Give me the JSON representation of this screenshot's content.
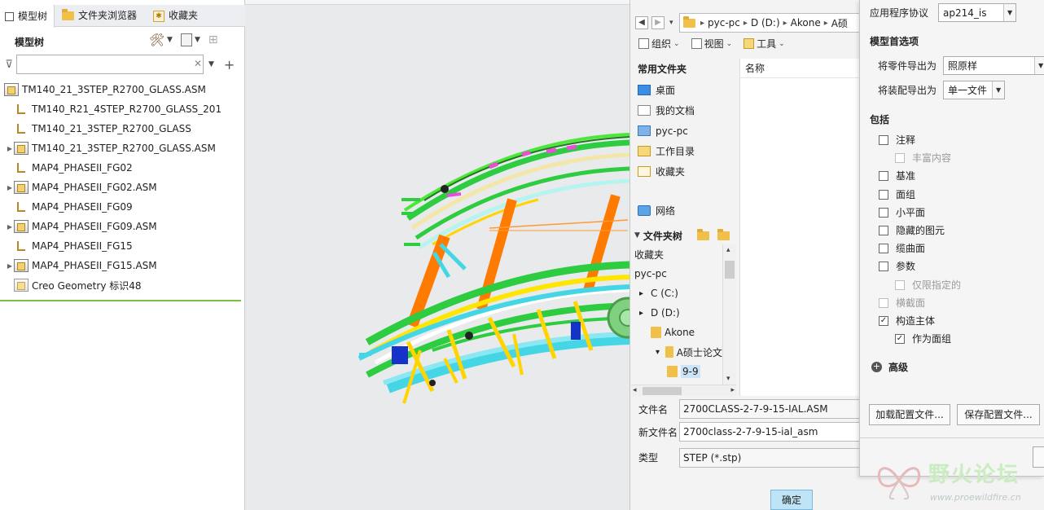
{
  "left_panel": {
    "tabs": [
      {
        "label": "模型树",
        "icon": "model-tree-icon"
      },
      {
        "label": "文件夹浏览器",
        "icon": "folder-browser-icon"
      },
      {
        "label": "收藏夹",
        "icon": "favorites-icon"
      }
    ],
    "title": "模型树",
    "filter": {
      "value": "",
      "placeholder": ""
    },
    "nodes": [
      {
        "label": "TM140_21_3STEP_R2700_GLASS.ASM",
        "type": "asm",
        "expandable": false,
        "indent": 0
      },
      {
        "label": "TM140_R21_4STEP_R2700_GLASS_201",
        "type": "part",
        "expandable": false,
        "indent": 1
      },
      {
        "label": "TM140_21_3STEP_R2700_GLASS",
        "type": "part",
        "expandable": false,
        "indent": 1
      },
      {
        "label": "TM140_21_3STEP_R2700_GLASS.ASM",
        "type": "asm",
        "expandable": true,
        "indent": 1
      },
      {
        "label": "MAP4_PHASEII_FG02",
        "type": "part",
        "expandable": false,
        "indent": 1
      },
      {
        "label": "MAP4_PHASEII_FG02.ASM",
        "type": "asm",
        "expandable": true,
        "indent": 1
      },
      {
        "label": "MAP4_PHASEII_FG09",
        "type": "part",
        "expandable": false,
        "indent": 1
      },
      {
        "label": "MAP4_PHASEII_FG09.ASM",
        "type": "asm",
        "expandable": true,
        "indent": 1
      },
      {
        "label": "MAP4_PHASEII_FG15",
        "type": "part",
        "expandable": false,
        "indent": 1
      },
      {
        "label": "MAP4_PHASEII_FG15.ASM",
        "type": "asm",
        "expandable": true,
        "indent": 1
      },
      {
        "label": "Creo Geometry 标识48",
        "type": "geom",
        "expandable": false,
        "indent": 1
      }
    ]
  },
  "dialog": {
    "breadcrumbs": [
      "pyc-pc",
      "D (D:)",
      "Akone",
      "A硕"
    ],
    "toolbar": {
      "organize": "组织",
      "view": "视图",
      "tools": "工具"
    },
    "places_title": "常用文件夹",
    "places": [
      {
        "label": "桌面",
        "icon": "desktop-icon",
        "cls": "desktop"
      },
      {
        "label": "我的文档",
        "icon": "documents-icon",
        "cls": "doc"
      },
      {
        "label": "pyc-pc",
        "icon": "computer-icon",
        "cls": "pc"
      },
      {
        "label": "工作目录",
        "icon": "working-directory-icon",
        "cls": "work"
      },
      {
        "label": "收藏夹",
        "icon": "favorites-icon",
        "cls": "fav"
      }
    ],
    "network": "网络",
    "folder_tree_title": "文件夹树",
    "folder_tree": [
      {
        "label": "收藏夹",
        "exp": "",
        "folder": false,
        "indent": 0,
        "sel": false
      },
      {
        "label": "pyc-pc",
        "exp": "",
        "folder": false,
        "indent": 0,
        "sel": false
      },
      {
        "label": "C (C:)",
        "exp": "▸",
        "folder": false,
        "indent": 1,
        "sel": false
      },
      {
        "label": "D (D:)",
        "exp": "▸",
        "folder": false,
        "indent": 1,
        "sel": false
      },
      {
        "label": "Akone",
        "exp": "",
        "folder": true,
        "indent": 2,
        "sel": false
      },
      {
        "label": "A硕士论文",
        "exp": "▾",
        "folder": true,
        "indent": 3,
        "sel": false
      },
      {
        "label": "9-9",
        "exp": "",
        "folder": true,
        "indent": 4,
        "sel": true
      }
    ],
    "list_header": "名称",
    "file_name_label": "文件名",
    "file_name_value": "2700CLASS-2-7-9-15-IAL.ASM",
    "new_name_label": "新文件名",
    "new_name_value": "2700class-2-7-9-15-ial_asm",
    "type_label": "类型",
    "type_value": "STEP (*.stp)",
    "ok_label": "确定"
  },
  "options": {
    "protocol_label": "应用程序协议",
    "protocol_value": "ap214_is",
    "model_prefs_title": "模型首选项",
    "export_parts_label": "将零件导出为",
    "export_parts_value": "照原样",
    "export_asm_label": "将装配导出为",
    "export_asm_value": "单一文件",
    "include_title": "包括",
    "includes": [
      {
        "label": "注释",
        "checked": false,
        "disabled": false,
        "indent": 0
      },
      {
        "label": "丰富内容",
        "checked": false,
        "disabled": true,
        "indent": 1
      },
      {
        "label": "基准",
        "checked": false,
        "disabled": false,
        "indent": 0
      },
      {
        "label": "面组",
        "checked": false,
        "disabled": false,
        "indent": 0
      },
      {
        "label": "小平面",
        "checked": false,
        "disabled": false,
        "indent": 0
      },
      {
        "label": "隐藏的图元",
        "checked": false,
        "disabled": false,
        "indent": 0
      },
      {
        "label": "缆曲面",
        "checked": false,
        "disabled": false,
        "indent": 0
      },
      {
        "label": "参数",
        "checked": false,
        "disabled": false,
        "indent": 0
      },
      {
        "label": "仅限指定的",
        "checked": false,
        "disabled": true,
        "indent": 1
      },
      {
        "label": "横截面",
        "checked": false,
        "disabled": true,
        "indent": 0
      },
      {
        "label": "构造主体",
        "checked": true,
        "disabled": false,
        "indent": 0
      },
      {
        "label": "作为面组",
        "checked": true,
        "disabled": false,
        "indent": 1
      }
    ],
    "advanced_label": "高级",
    "load_config_label": "加载配置文件...",
    "save_config_label": "保存配置文件..."
  },
  "watermark": {
    "text": "野火论坛",
    "url": "www.proewildfire.cn"
  },
  "colors": {
    "accent_green": "#7ac142",
    "selection_blue": "#cce4f7",
    "ok_button": "#bfe3f7"
  }
}
